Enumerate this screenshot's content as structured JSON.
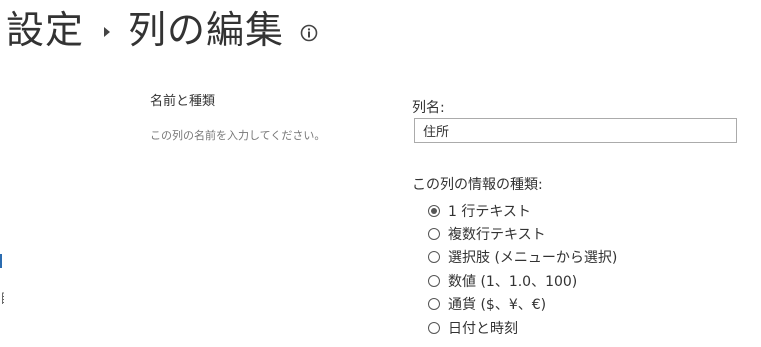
{
  "header": {
    "crumb_settings": "設定",
    "crumb_current": "列の編集",
    "info_icon": "info-icon"
  },
  "section": {
    "title": "名前と種類",
    "description": "この列の名前を入力してください。"
  },
  "column_name": {
    "label": "列名:",
    "value": "住所"
  },
  "info_type": {
    "label": "この列の情報の種類:",
    "selected_index": 0,
    "options": [
      "1 行テキスト",
      "複数行テキスト",
      "選択肢 (メニューから選択)",
      "数値 (1、1.0、100)",
      "通貨 ($、¥、€)",
      "日付と時刻"
    ]
  },
  "left_edge": {
    "partial_glyph": "目"
  }
}
